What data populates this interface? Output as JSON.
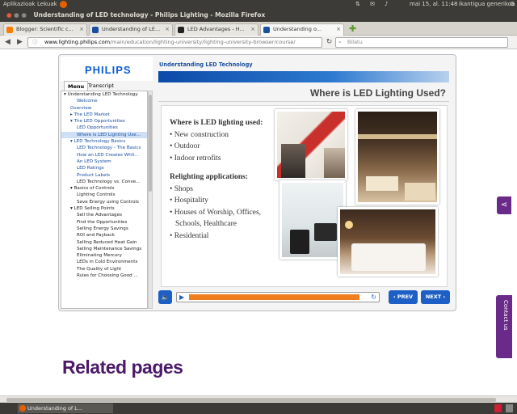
{
  "panel": {
    "apps": "Aplikazioak",
    "places": "Lekuak",
    "clock": "mai 15, al. 11:48",
    "user": "ikantigua generikoa"
  },
  "window_title": "Understanding of LED technology - Philips Lighting - Mozilla Firefox",
  "tabs": [
    {
      "label": "Blogger: Scientific c...",
      "color": "#f57d00"
    },
    {
      "label": "Understanding of LE...",
      "color": "#1a4fa0"
    },
    {
      "label": "LED Advantages - H...",
      "color": "#222222"
    },
    {
      "label": "Understanding o...",
      "color": "#1a4fa0"
    }
  ],
  "url": {
    "host": "www.lighting.philips.com",
    "path": "/main/education/lighting-university/lighting-university-browser/course/"
  },
  "search_placeholder": "Bilatu",
  "course": {
    "logo": "PHILIPS",
    "menu_tab": "Menu",
    "transcript_tab": "Transcript",
    "breadcrumb": "Understanding LED Technology",
    "slide_title": "Where is LED Lighting Used?",
    "toc": [
      {
        "label": "▾ Understanding LED Technology",
        "indent": 0,
        "kind": "head"
      },
      {
        "label": "Welcome",
        "indent": 2,
        "kind": "link"
      },
      {
        "label": "Overview",
        "indent": 1,
        "kind": "link"
      },
      {
        "label": "▸ The LED Market",
        "indent": 1,
        "kind": "link"
      },
      {
        "label": "▾ The LED Opportunities",
        "indent": 1,
        "kind": "link"
      },
      {
        "label": "LED Opportunities",
        "indent": 2,
        "kind": "link"
      },
      {
        "label": "Where is LED Lighting Use...",
        "indent": 2,
        "kind": "sel"
      },
      {
        "label": "▾ LED Technology Basics",
        "indent": 1,
        "kind": "link"
      },
      {
        "label": "LED Technology - The Basics",
        "indent": 2,
        "kind": "link"
      },
      {
        "label": "How an LED Creates Whit...",
        "indent": 2,
        "kind": "link"
      },
      {
        "label": "An LED System",
        "indent": 2,
        "kind": "link"
      },
      {
        "label": "LED Ratings",
        "indent": 2,
        "kind": "link"
      },
      {
        "label": "Product Labels",
        "indent": 2,
        "kind": "link"
      },
      {
        "label": "LED Technology vs. Conve...",
        "indent": 2,
        "kind": "head"
      },
      {
        "label": "▾ Basics of Controls",
        "indent": 1,
        "kind": "head"
      },
      {
        "label": "Lighting Controls",
        "indent": 2,
        "kind": "head"
      },
      {
        "label": "Save Energy using Controls",
        "indent": 2,
        "kind": "head"
      },
      {
        "label": "▾ LED Selling Points",
        "indent": 1,
        "kind": "head"
      },
      {
        "label": "Sell the Advantages",
        "indent": 2,
        "kind": "head"
      },
      {
        "label": "Find the Opportunities",
        "indent": 2,
        "kind": "head"
      },
      {
        "label": "Selling Energy Savings",
        "indent": 2,
        "kind": "head"
      },
      {
        "label": "ROI and Payback",
        "indent": 2,
        "kind": "head"
      },
      {
        "label": "Selling Reduced Heat Gain",
        "indent": 2,
        "kind": "head"
      },
      {
        "label": "Selling Maintenance Savings",
        "indent": 2,
        "kind": "head"
      },
      {
        "label": "Eliminating Mercury",
        "indent": 2,
        "kind": "head"
      },
      {
        "label": "LEDs in Cold Environments",
        "indent": 2,
        "kind": "head"
      },
      {
        "label": "The Quality of Light",
        "indent": 2,
        "kind": "head"
      },
      {
        "label": "Rules for Choosing Good ...",
        "indent": 2,
        "kind": "head"
      }
    ],
    "slide": {
      "heading1": "Where is LED lighting used:",
      "list1": [
        "New construction",
        "Outdoor",
        "Indoor retrofits"
      ],
      "heading2": "Relighting applications:",
      "list2": [
        "Shops",
        "Hospitality",
        "Houses of Worship, Offices, Schools, Healthcare",
        "Residential"
      ]
    },
    "progress": 0.95,
    "prev": "‹ PREV",
    "next": "NEXT ›"
  },
  "related_heading": "Related pages",
  "contact_tab": "Contact us",
  "taskbar_item": "Understanding of L..."
}
